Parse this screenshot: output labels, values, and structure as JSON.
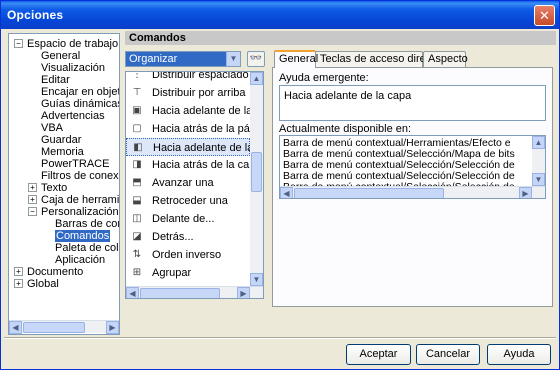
{
  "window": {
    "title": "Opciones"
  },
  "tree": {
    "items": [
      {
        "label": "Espacio de trabajo",
        "expander": "−"
      },
      {
        "label": "General"
      },
      {
        "label": "Visualización"
      },
      {
        "label": "Editar"
      },
      {
        "label": "Encajar en objetos"
      },
      {
        "label": "Guías dinámicas"
      },
      {
        "label": "Advertencias"
      },
      {
        "label": "VBA"
      },
      {
        "label": "Guardar"
      },
      {
        "label": "Memoria"
      },
      {
        "label": "PowerTRACE"
      },
      {
        "label": "Filtros de conexión"
      },
      {
        "label": "Texto",
        "expander": "+"
      },
      {
        "label": "Caja de herramient",
        "expander": "+"
      },
      {
        "label": "Personalización",
        "expander": "−"
      },
      {
        "label": "Barras de coma"
      },
      {
        "label": "Comandos"
      },
      {
        "label": "Paleta de colore"
      },
      {
        "label": "Aplicación"
      },
      {
        "label": "Documento",
        "expander": "+"
      },
      {
        "label": "Global",
        "expander": "+"
      }
    ]
  },
  "header": {
    "title": "Comandos"
  },
  "filter": {
    "selected": "Organizar"
  },
  "commands": {
    "items": [
      {
        "label": "Distribuir espaciado vert",
        "icon": "⋮"
      },
      {
        "label": "Distribuir por arriba",
        "icon": "⊤"
      },
      {
        "label": "Hacia adelante de la pág",
        "icon": "▣"
      },
      {
        "label": "Hacia atrás de la página",
        "icon": "▢"
      },
      {
        "label": "Hacia adelante de la cap",
        "icon": "◧"
      },
      {
        "label": "Hacia atrás de la capa",
        "icon": "◨"
      },
      {
        "label": "Avanzar una",
        "icon": "⬒"
      },
      {
        "label": "Retroceder una",
        "icon": "⬓"
      },
      {
        "label": "Delante de...",
        "icon": "◫"
      },
      {
        "label": "Detrás...",
        "icon": "◪"
      },
      {
        "label": "Orden inverso",
        "icon": "⇅"
      },
      {
        "label": "Agrupar",
        "icon": "⊞"
      }
    ]
  },
  "tabs": {
    "general": "General",
    "shortcuts": "Teclas de acceso directo",
    "appearance": "Aspecto"
  },
  "general": {
    "tooltip_label": "Ayuda emergente:",
    "tooltip_value": "Hacia adelante de la capa",
    "available_label": "Actualmente disponible en:",
    "available": [
      "Barra de menú contextual/Herramientas/Efecto e",
      "Barra de menú contextual/Selección/Mapa de bits",
      "Barra de menú contextual/Selección/Selección de",
      "Barra de menú contextual/Selección/Selección de",
      "Barra de menú contextual/Selección/Selección de"
    ]
  },
  "buttons": {
    "ok": "Aceptar",
    "cancel": "Cancelar",
    "help": "Ayuda"
  }
}
